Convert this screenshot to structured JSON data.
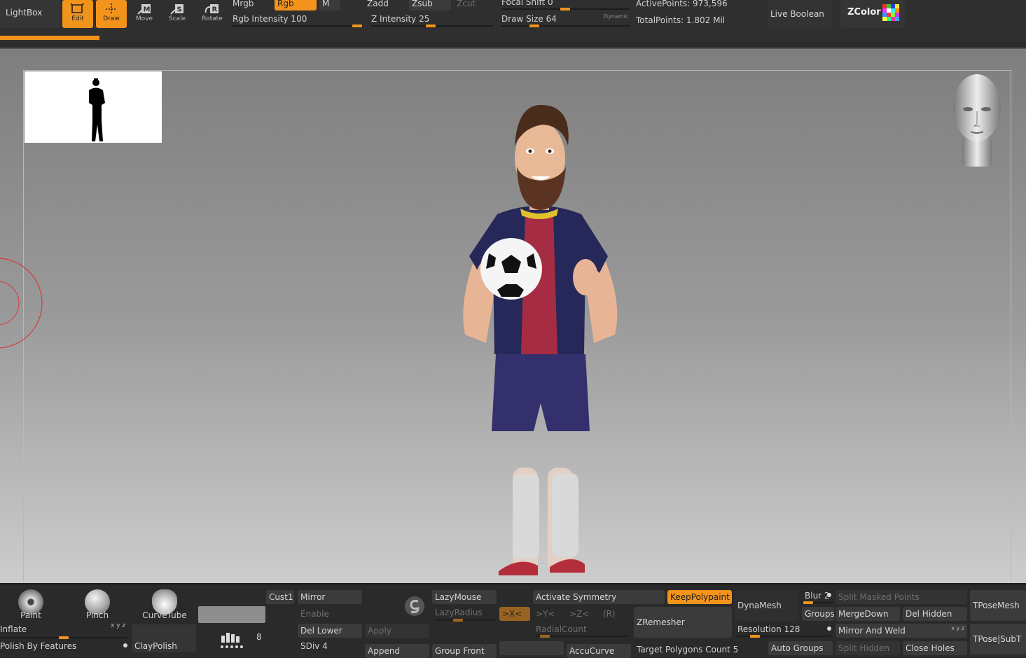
{
  "top": {
    "lightbox": "LightBox",
    "tools": [
      {
        "label": "Edit",
        "icon": "edit-icon",
        "active": true
      },
      {
        "label": "Draw",
        "icon": "draw-icon",
        "active": true
      },
      {
        "label": "Move",
        "icon": "move-icon",
        "active": false
      },
      {
        "label": "Scale",
        "icon": "scale-icon",
        "active": false
      },
      {
        "label": "Rotate",
        "icon": "rotate-icon",
        "active": false
      }
    ],
    "mrgb": "Mrgb",
    "rgb": "Rgb",
    "m": "M",
    "rgb_intensity": "Rgb Intensity 100",
    "zadd": "Zadd",
    "zsub": "Zsub",
    "zcut": "Zcut",
    "z_intensity": "Z Intensity 25",
    "focal_shift": "Focal Shift 0",
    "draw_size": "Draw Size 64",
    "dynamic": "Dynamic",
    "active_points": "ActivePoints: 973,596",
    "total_points": "TotalPoints: 1.802 Mil",
    "live_boolean": "Live Boolean",
    "zcolor": "ZColor",
    "accent": "#f2931c"
  },
  "canvas": {
    "head_icon": "navigation-head-icon",
    "thumbnail_icon": "silhouette-thumbnail-icon"
  },
  "bottom": {
    "brushes": [
      {
        "label": "Paint"
      },
      {
        "label": "Pinch"
      },
      {
        "label": "CurveTube"
      }
    ],
    "inflate": "Inflate",
    "xyz": "x y z",
    "polish_by_features": "Polish By Features",
    "claypolish": "ClayPolish",
    "stroke_count": "8",
    "cust1": "Cust1",
    "mirror": "Mirror",
    "enable": "Enable",
    "del_lower": "Del Lower",
    "apply": "Apply",
    "sdiv": "SDiv 4",
    "append": "Append",
    "group_front": "Group Front",
    "lazymouse": "LazyMouse",
    "lazyradius": "LazyRadius",
    "activate_symmetry": "Activate Symmetry",
    "x_axis": ">X<",
    "y_axis": ">Y<",
    "z_axis": ">Z<",
    "r_axis": "(R)",
    "radialcount": "RadialCount",
    "accucurve": "AccuCurve",
    "keeppolypaint": "KeepPolypaint",
    "zremesher": "ZRemesher",
    "target_polygons": "Target Polygons Count 5",
    "dynamesh": "DynaMesh",
    "resolution": "Resolution 128",
    "blur": "Blur 2",
    "groups": "Groups",
    "auto_groups": "Auto Groups",
    "split_masked": "Split Masked Points",
    "mergedown": "MergeDown",
    "del_hidden": "Del Hidden",
    "mirror_and_weld": "Mirror And Weld",
    "split_hidden": "Split Hidden",
    "close_holes": "Close Holes",
    "tposemesh": "TPoseMesh",
    "tpose_subt": "TPose|SubT"
  }
}
